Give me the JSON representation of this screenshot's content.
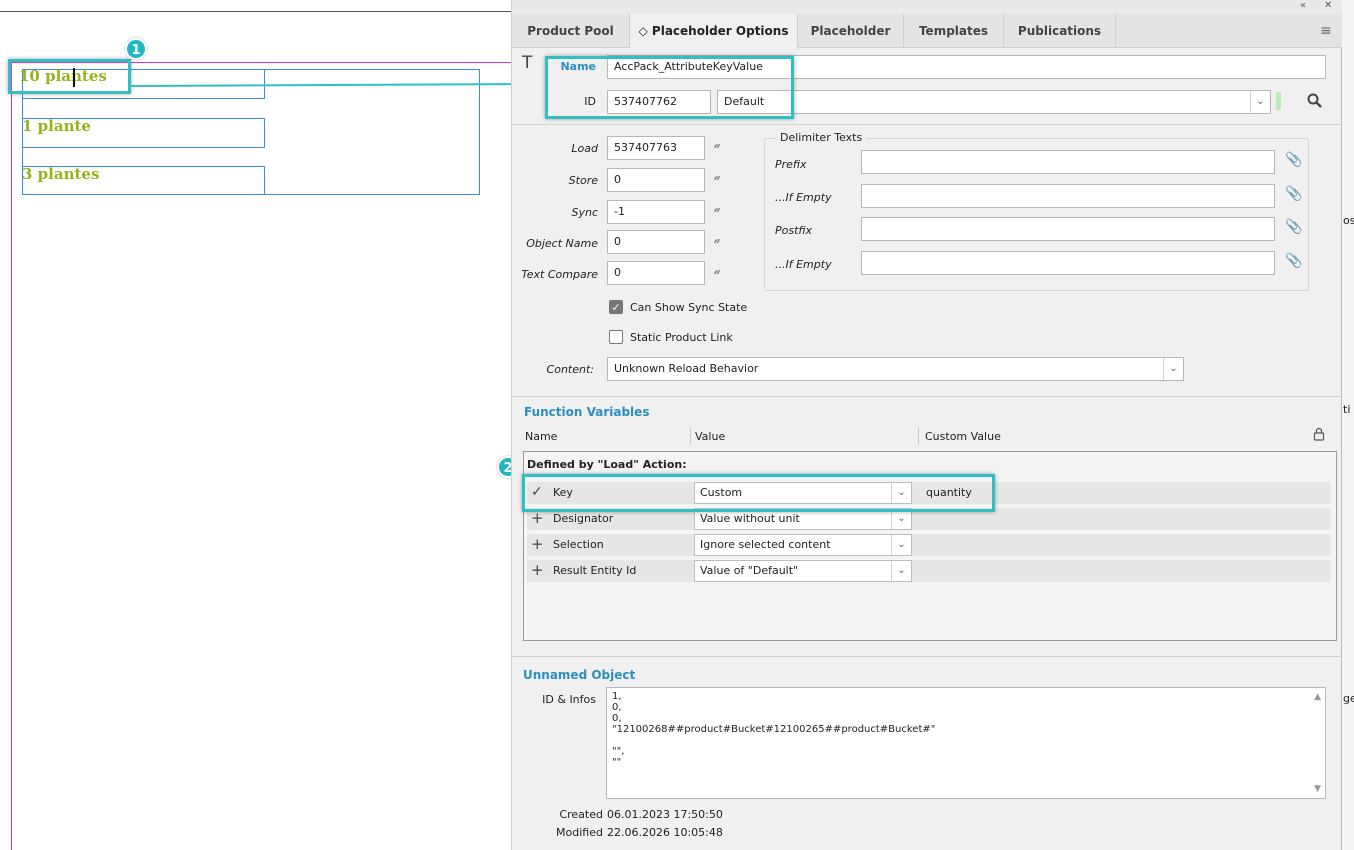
{
  "canvas": {
    "items": [
      "10 plantes",
      "1 plante",
      "3 plantes"
    ],
    "badge1": "1",
    "badge2": "2"
  },
  "window_controls": {
    "collapse": "«",
    "close": "✕"
  },
  "tabs": [
    {
      "label": "Product Pool"
    },
    {
      "label": "◇ Placeholder Options"
    },
    {
      "label": "Placeholder"
    },
    {
      "label": "Templates"
    },
    {
      "label": "Publications"
    }
  ],
  "header": {
    "type_icon": "T",
    "name_label": "Name",
    "name_value": "AccPack_AttributeKeyValue",
    "id_label": "ID",
    "id_value": "537407762",
    "id_select": "Default"
  },
  "actions": {
    "load_label": "Load",
    "load_value": "537407763",
    "store_label": "Store",
    "store_value": "0",
    "sync_label": "Sync",
    "sync_value": "-1",
    "object_name_label": "Object Name",
    "object_name_value": "0",
    "text_compare_label": "Text Compare",
    "text_compare_value": "0"
  },
  "delimiter": {
    "title": "Delimiter Texts",
    "prefix_label": "Prefix",
    "if_empty_label": "...If Empty",
    "postfix_label": "Postfix",
    "if_empty2_label": "...If Empty"
  },
  "options": {
    "can_show_sync": "Can Show Sync State",
    "static_link": "Static Product Link",
    "content_label": "Content:",
    "content_value": "Unknown Reload Behavior"
  },
  "function_vars": {
    "title": "Function Variables",
    "col_name": "Name",
    "col_value": "Value",
    "col_custom": "Custom Value",
    "group": "Defined by \"Load\" Action:",
    "rows": [
      {
        "mark": "✓",
        "name": "Key",
        "value": "Custom",
        "custom": "quantity"
      },
      {
        "mark": "+",
        "name": "Designator",
        "value": "Value without unit",
        "custom": ""
      },
      {
        "mark": "+",
        "name": "Selection",
        "value": "Ignore selected content",
        "custom": ""
      },
      {
        "mark": "+",
        "name": "Result Entity Id",
        "value": "Value of \"Default\"",
        "custom": ""
      }
    ]
  },
  "unnamed": {
    "title": "Unnamed Object",
    "ids_label": "ID & Infos",
    "lines": [
      "1,",
      "0,",
      "0,",
      "\"12100268##product#Bucket#12100265##product#Bucket#\"",
      "",
      "\"\",",
      "\"\""
    ],
    "created_label": "Created",
    "created_value": "06.01.2023 17:50:50",
    "modified_label": "Modified",
    "modified_value": "22.06.2026 10:05:48"
  },
  "right_edge": [
    "os",
    "ti",
    "ge"
  ]
}
